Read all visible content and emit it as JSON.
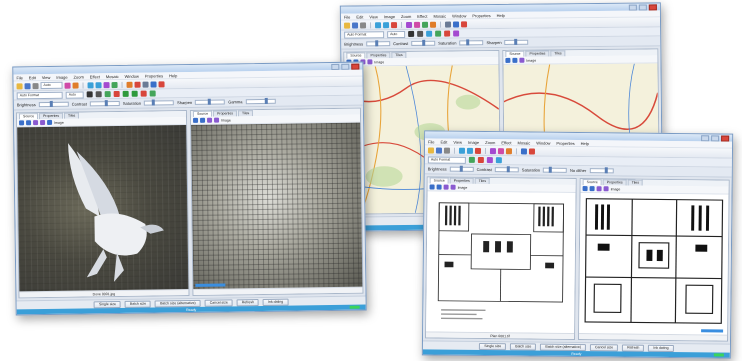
{
  "menu": [
    "File",
    "Edit",
    "View",
    "Image",
    "Zoom",
    "Effect",
    "Mosaic",
    "Window",
    "Properties",
    "Help"
  ],
  "tabs": [
    "Source",
    "Properties",
    "Tiles"
  ],
  "options": {
    "size_value": "Auto",
    "font_value": "Auto Format"
  },
  "sliders": {
    "brightness": "Brightness",
    "contrast": "Contrast",
    "saturation": "Saturation",
    "sharpen": "Sharpen",
    "gamma": "Gamma",
    "nodithering": "No dither"
  },
  "pane_label": "Image",
  "footers": {
    "dove": "Dove 0001.jpg",
    "plan": "Plan 0001.tif"
  },
  "buttons": [
    "Single size",
    "Batch size",
    "Batch size (alternative)",
    "Cancel size",
    "Refresh",
    "Ink dating"
  ],
  "status": "Ready",
  "colors": {
    "accent": "#3b9fd8",
    "frame": "#7a9bc4",
    "progress": "#3bd45a"
  }
}
